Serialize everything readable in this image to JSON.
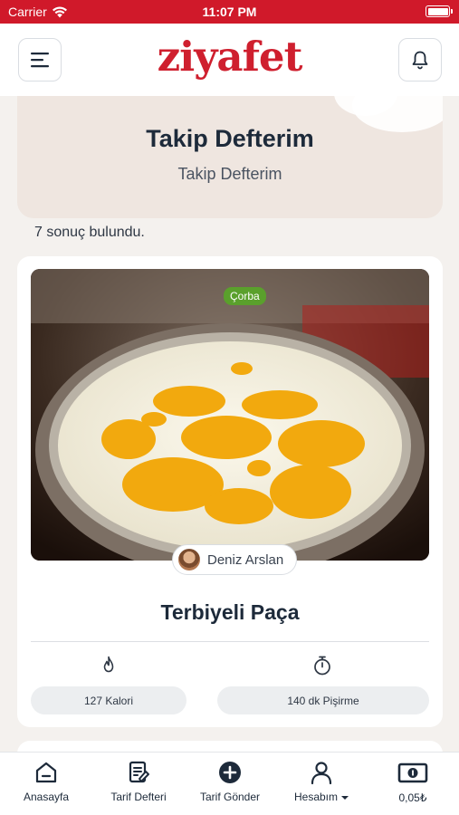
{
  "status_bar": {
    "carrier": "Carrier",
    "time": "11:07 PM"
  },
  "header": {
    "logo_text": "ziyafet",
    "menu_icon": "hamburger-menu-icon",
    "notification_icon": "bell-icon"
  },
  "hero": {
    "title": "Takip Defterim",
    "subtitle": "Takip Defterim"
  },
  "results": {
    "count_text": "7 sonuç bulundu."
  },
  "recipe_card": {
    "category": "Çorba",
    "author": "Deniz Arslan",
    "title": "Terbiyeli Paça",
    "calories": "127 Kalori",
    "cook_time": "140 dk Pişirme",
    "calories_icon": "flame-icon",
    "time_icon": "stopwatch-icon"
  },
  "tab_bar": {
    "items": [
      {
        "label": "Anasayfa",
        "icon": "home-icon"
      },
      {
        "label": "Tarif Defteri",
        "icon": "recipe-book-icon"
      },
      {
        "label": "Tarif Gönder",
        "icon": "plus-circle-icon"
      },
      {
        "label": "Hesabım",
        "icon": "user-icon"
      },
      {
        "label": "0,05₺",
        "icon": "money-icon"
      }
    ]
  },
  "colors": {
    "brand_red": "#d0192a",
    "category_green": "#5aa02c",
    "hero_bg": "#efe6e0",
    "text_dark": "#1d2a3a"
  }
}
